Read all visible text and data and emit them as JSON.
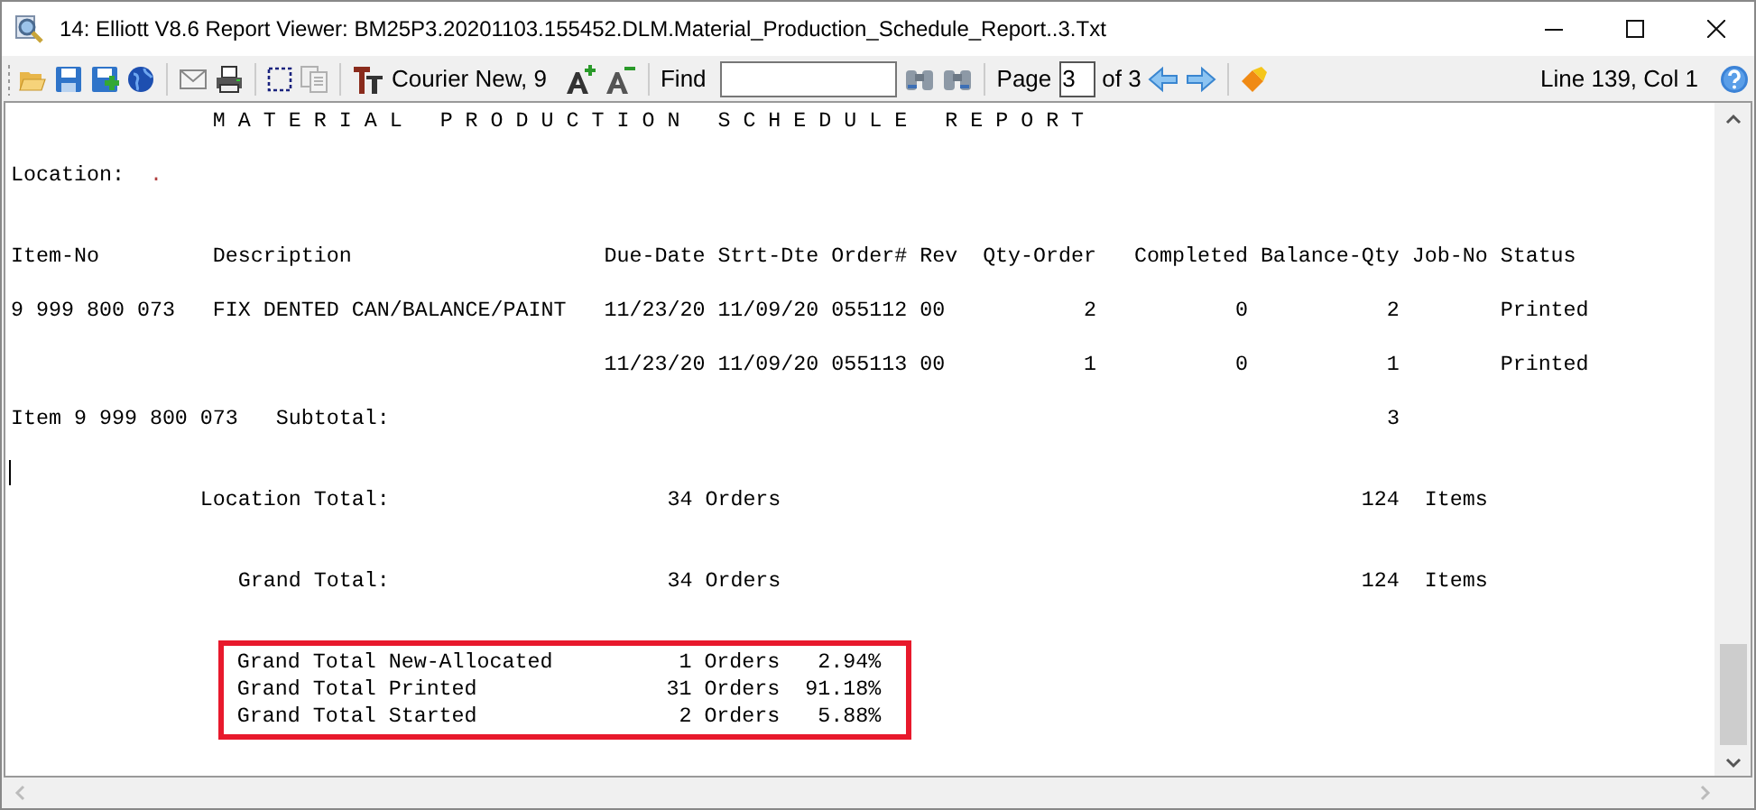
{
  "window": {
    "title": "14: Elliott V8.6 Report Viewer: BM25P3.20201103.155452.DLM.Material_Production_Schedule_Report..3.Txt"
  },
  "toolbar": {
    "font": "Courier New, 9",
    "find_label": "Find",
    "page_label": "Page",
    "page_value": "3",
    "page_of": "of 3",
    "copy_disabled": true,
    "position": "Line 139, Col 1"
  },
  "report": {
    "title": "M A T E R I A L   P R O D U C T I O N   S C H E D U L E   R E P O R T",
    "location_label": "Location:",
    "location_value": ".",
    "columns": [
      "Item-No",
      "Description",
      "Due-Date",
      "Strt-Dte",
      "Order#",
      "Rev",
      "Qty-Order",
      "Completed",
      "Balance-Qty",
      "Job-No",
      "Status"
    ],
    "rows": [
      {
        "item_no": "9 999 800 073",
        "description": "FIX DENTED CAN/BALANCE/PAINT",
        "due_date": "11/23/20",
        "start_date": "11/09/20",
        "order_no": "055112",
        "rev": "00",
        "qty_order": "2",
        "completed": "0",
        "balance_qty": "2",
        "status": "Printed"
      },
      {
        "due_date": "11/23/20",
        "start_date": "11/09/20",
        "order_no": "055113",
        "rev": "00",
        "qty_order": "1",
        "completed": "0",
        "balance_qty": "1",
        "status": "Printed"
      }
    ],
    "subtotal": {
      "item": "Item 9 999 800 073",
      "label": "Subtotal:",
      "value": "3"
    },
    "totals": [
      {
        "label": "Location Total:",
        "orders": "34",
        "orders_label": "Orders",
        "items": "124",
        "items_label": "Items"
      },
      {
        "label": "Grand Total:",
        "orders": "34",
        "orders_label": "Orders",
        "items": "124",
        "items_label": "Items"
      }
    ],
    "breakdown_highlighted": true,
    "breakdown": [
      {
        "label": "Grand Total New-Allocated",
        "orders": "1",
        "orders_label": "Orders",
        "percent": "2.94%"
      },
      {
        "label": "Grand Total Printed",
        "orders": "31",
        "orders_label": "Orders",
        "percent": "91.18%"
      },
      {
        "label": "Grand Total Started",
        "orders": "2",
        "orders_label": "Orders",
        "percent": "5.88%"
      }
    ]
  }
}
